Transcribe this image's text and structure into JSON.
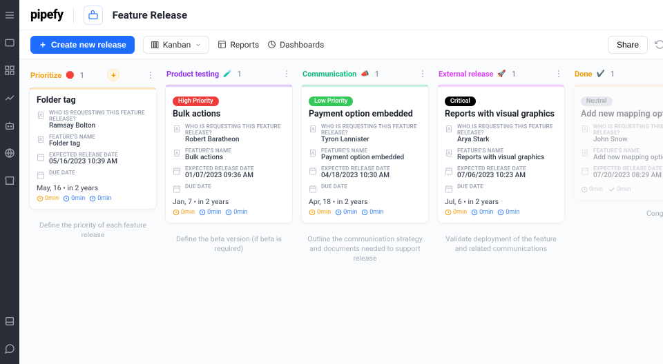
{
  "app": {
    "logo": "pipefy",
    "pipeTitle": "Feature Release"
  },
  "toolbar": {
    "create": "Create new release",
    "view": "Kanban",
    "reports": "Reports",
    "dashboards": "Dashboards",
    "share": "Share"
  },
  "columns": [
    {
      "name": "Prioritize",
      "emoji": "🛑",
      "count": "1",
      "color": "#f59e0b",
      "caption": "Define the priority of each feature release",
      "cards": [
        {
          "title": "Folder tag",
          "priority": null,
          "requester": "Ramsay Bolton",
          "feature": "Folder tag",
          "expected": "05/16/2023 10:39 AM",
          "due": "May, 16 • in 2 years",
          "timers": [
            "0min",
            "0min",
            "0min"
          ]
        }
      ]
    },
    {
      "name": "Product testing",
      "emoji": "🧪",
      "count": "1",
      "color": "#9333ea",
      "caption": "Define the beta version (if beta is required)",
      "cards": [
        {
          "title": "Bulk actions",
          "priority": "High Priority",
          "priorityClass": "b-high",
          "requester": "Robert Baratheon",
          "feature": "Bulk actions",
          "expected": "01/07/2023 09:36 AM",
          "due": "Jan, 7 • in 2 years",
          "timers": [
            "0min",
            "0min",
            "0min"
          ]
        }
      ]
    },
    {
      "name": "Communication",
      "emoji": "📣",
      "count": "1",
      "color": "#10b981",
      "caption": "Outline the communication strategy and documents needed to support release",
      "cards": [
        {
          "title": "Payment option embedded",
          "priority": "Low Priority",
          "priorityClass": "b-low",
          "requester": "Tyron Lannister",
          "feature": "Payment option embedded",
          "expected": "04/18/2023 10:30 AM",
          "due": "Apr, 18 • in 2 years",
          "timers": [
            "0min",
            "0min",
            "0min"
          ]
        }
      ]
    },
    {
      "name": "External release",
      "emoji": "🚀",
      "count": "1",
      "color": "#d946ef",
      "caption": "Validate deployment of the feature and related communications",
      "cards": [
        {
          "title": "Reports with visual graphics",
          "priority": "Critical",
          "priorityClass": "b-crit",
          "requester": "Arya Stark",
          "feature": "Reports with visual graphics",
          "expected": "07/06/2023 10:23 AM",
          "due": "Jul, 6 • in 2 years",
          "timers": [
            "0min",
            "0min",
            "0min"
          ]
        }
      ]
    },
    {
      "name": "Done",
      "emoji": "✔️",
      "count": "1",
      "color": "#f59e0b",
      "done": true,
      "congrats": "Congratulations!",
      "cards": [
        {
          "title": "Add new mapping option",
          "priority": "Neutral",
          "priorityClass": "b-neutral",
          "requester": "John Snow",
          "feature": "Add new mapping option",
          "expected": "07/20/2023 08:29 AM",
          "timers": [
            "0min",
            "0min"
          ]
        }
      ]
    }
  ],
  "labels": {
    "requester": "WHO IS REQUESTING THIS FEATURE RELEASE?",
    "feature": "FEATURE'S NAME",
    "expected": "EXPECTED RELEASE DATE",
    "due": "DUE DATE"
  }
}
